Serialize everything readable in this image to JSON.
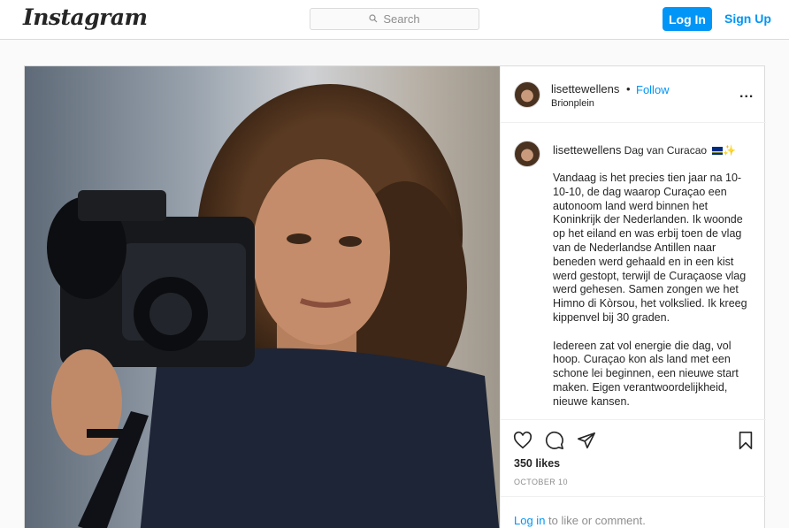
{
  "header": {
    "logo": "Instagram",
    "search_placeholder": "Search",
    "login_label": "Log In",
    "signup_label": "Sign Up",
    "icons": {
      "search": "magnifier-icon"
    }
  },
  "post": {
    "username": "lisettewellens",
    "separator": "•",
    "follow_label": "Follow",
    "location": "Brionplein",
    "more_label": "...",
    "caption_title": "Dag van Curacao",
    "caption_emojis": [
      "curacao-flag-icon",
      "sparkles-icon"
    ],
    "caption_text": "Vandaag is het precies tien jaar na 10-10-10, de dag waarop Curaçao een autonoom land werd binnen het Koninkrijk der Nederlanden. Ik woonde op het eiland en was erbij toen de vlag van de Nederlandse Antillen naar beneden werd gehaald en in een kist werd gestopt, terwijl de Curaçaose vlag werd gehesen. Samen zongen we het Himno di Kòrsou, het volkslied. Ik kreeg kippenvel bij 30 graden.\n\nIedereen zat vol energie die dag, vol hoop. Curaçao kon als land met een schone lei beginnen, een nieuwe start maken. Eigen verantwoordelijkheid, nieuwe kansen.",
    "likes": "350 likes",
    "date": "OCTOBER 10",
    "login_link": "Log in",
    "login_suffix": " to like or comment.",
    "action_icons": [
      "heart-icon",
      "comment-icon",
      "share-icon",
      "bookmark-icon"
    ]
  },
  "colors": {
    "accent": "#0095f6",
    "border": "#dbdbdb",
    "text": "#262626",
    "muted": "#8e8e8e"
  }
}
